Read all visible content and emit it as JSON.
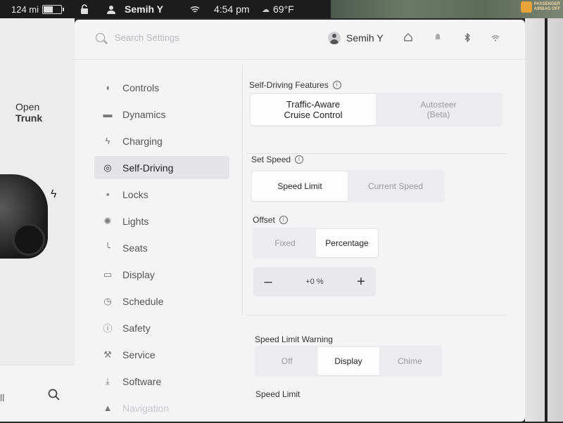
{
  "status": {
    "range": "124 mi",
    "battery_percent": 60,
    "user": "Semih Y",
    "time": "4:54 pm",
    "temperature": "69°F",
    "airbag_line1": "PASSENGER",
    "airbag_line2": "AIRBAG OFF"
  },
  "car_panel": {
    "open_label": "Open",
    "trunk_label": "Trunk",
    "bottom_text": "ll"
  },
  "header": {
    "search_placeholder": "Search Settings",
    "user_name": "Semih Y",
    "icons": [
      "home-icon",
      "bell-icon",
      "bluetooth-icon",
      "wifi-icon"
    ]
  },
  "nav": {
    "items": [
      {
        "label": "Controls",
        "icon": "toggle-icon"
      },
      {
        "label": "Dynamics",
        "icon": "car-icon"
      },
      {
        "label": "Charging",
        "icon": "bolt-icon"
      },
      {
        "label": "Self-Driving",
        "icon": "steering-wheel-icon"
      },
      {
        "label": "Locks",
        "icon": "lock-icon"
      },
      {
        "label": "Lights",
        "icon": "sun-icon"
      },
      {
        "label": "Seats",
        "icon": "seat-icon"
      },
      {
        "label": "Display",
        "icon": "display-icon"
      },
      {
        "label": "Schedule",
        "icon": "alarm-icon"
      },
      {
        "label": "Safety",
        "icon": "safety-icon"
      },
      {
        "label": "Service",
        "icon": "wrench-icon"
      },
      {
        "label": "Software",
        "icon": "download-icon"
      },
      {
        "label": "Navigation",
        "icon": "navigation-icon"
      }
    ],
    "active": "Self-Driving"
  },
  "content": {
    "features": {
      "title": "Self-Driving Features",
      "options": [
        "Traffic-Aware\nCruise Control",
        "Autosteer\n(Beta)"
      ],
      "selected": 0
    },
    "set_speed": {
      "title": "Set Speed",
      "options": [
        "Speed Limit",
        "Current Speed"
      ],
      "selected": 0
    },
    "offset": {
      "title": "Offset",
      "options": [
        "Fixed",
        "Percentage"
      ],
      "selected": 1,
      "minus": "–",
      "value": "+0 %",
      "plus": "+"
    },
    "speed_limit_warning": {
      "title": "Speed Limit Warning",
      "options": [
        "Off",
        "Display",
        "Chime"
      ],
      "selected": 1
    },
    "speed_limit": {
      "title": "Speed Limit"
    }
  }
}
